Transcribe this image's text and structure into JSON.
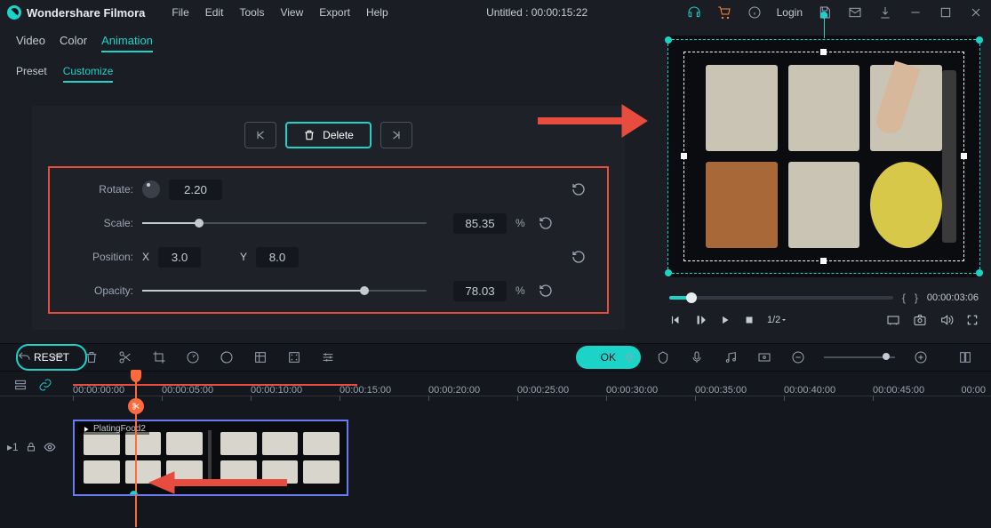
{
  "app": {
    "name": "Wondershare Filmora"
  },
  "menu": {
    "items": [
      "File",
      "Edit",
      "Tools",
      "View",
      "Export",
      "Help"
    ]
  },
  "document": {
    "title": "Untitled : 00:00:15:22"
  },
  "topbar": {
    "login": "Login"
  },
  "tabs": {
    "items": [
      "Video",
      "Color",
      "Animation"
    ],
    "active": "Animation"
  },
  "subtabs": {
    "items": [
      "Preset",
      "Customize"
    ],
    "active": "Customize"
  },
  "actions": {
    "delete": "Delete",
    "reset": "RESET",
    "ok": "OK"
  },
  "props": {
    "rotate": {
      "label": "Rotate:",
      "value": "2.20"
    },
    "scale": {
      "label": "Scale:",
      "value": "85.35",
      "pct": 85.35
    },
    "position": {
      "label": "Position:",
      "xlabel": "X",
      "x": "3.0",
      "ylabel": "Y",
      "y": "8.0"
    },
    "opacity": {
      "label": "Opacity:",
      "value": "78.03",
      "pct": 78.03
    }
  },
  "preview": {
    "timecode": "00:00:03:06",
    "speed": "1/2"
  },
  "timeline": {
    "ticks": [
      "00:00:00:00",
      "00:00:05:00",
      "00:00:10:00",
      "00:00:15:00",
      "00:00:20:00",
      "00:00:25:00",
      "00:00:30:00",
      "00:00:35:00",
      "00:00:40:00",
      "00:00:45:00"
    ],
    "end_label": "00:00",
    "clip_name": "PlatingFood2",
    "track_label": "1"
  }
}
